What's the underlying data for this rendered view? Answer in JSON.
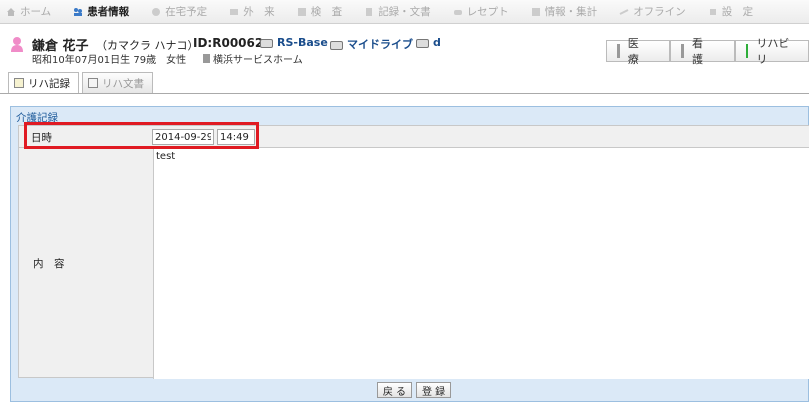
{
  "nav": {
    "items": [
      {
        "label": "ホーム",
        "icon": "home-icon",
        "active": false
      },
      {
        "label": "患者情報",
        "icon": "patient-icon",
        "active": true
      },
      {
        "label": "在宅予定",
        "icon": "calendar-icon",
        "active": false
      },
      {
        "label": "外　来",
        "icon": "outpatient-icon",
        "active": false
      },
      {
        "label": "検　査",
        "icon": "exam-icon",
        "active": false
      },
      {
        "label": "記録・文書",
        "icon": "document-icon",
        "active": false
      },
      {
        "label": "レセプト",
        "icon": "receipt-icon",
        "active": false
      },
      {
        "label": "情報・集計",
        "icon": "stats-icon",
        "active": false
      },
      {
        "label": "オフライン",
        "icon": "offline-icon",
        "active": false
      },
      {
        "label": "設　定",
        "icon": "settings-icon",
        "active": false
      }
    ]
  },
  "patient": {
    "name": "鎌倉 花子",
    "kana": "（カマクラ ハナコ）",
    "id": "ID:R00062",
    "links": [
      "RS-Base",
      "マイドライブ",
      "d"
    ],
    "birth": "昭和10年07月01日生  79歳　女性",
    "facility": "横浜サービスホーム"
  },
  "modes": [
    {
      "label": "医　療",
      "active": false
    },
    {
      "label": "看　護",
      "active": false
    },
    {
      "label": "リハビリ",
      "active": true
    }
  ],
  "tabs": [
    {
      "label": "リハ記録",
      "active": true
    },
    {
      "label": "リハ文書",
      "active": false
    }
  ],
  "panel": {
    "title": "介護記録",
    "datetime_label": "日時",
    "date_value": "2014-09-29",
    "time_value": "14:49",
    "content_label": "内　容",
    "content_value": "test"
  },
  "footer": {
    "back_label": "戻 る",
    "register_label": "登 録"
  },
  "colors": {
    "highlight": "#e01a22",
    "panel_bg": "#dbe9f7",
    "link": "#1a4d8c",
    "active_mode": "#2eae3a"
  }
}
